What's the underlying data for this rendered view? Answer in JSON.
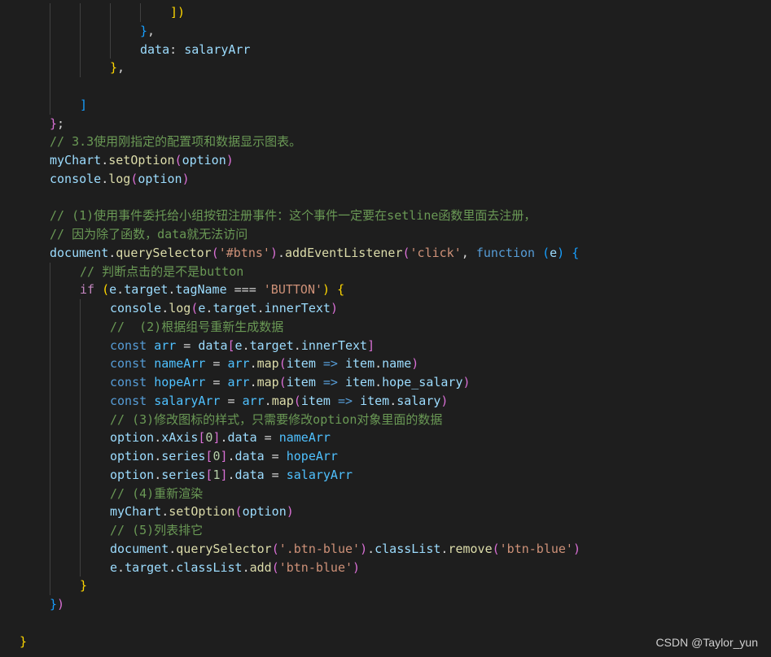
{
  "editor": {
    "theme": "dark",
    "colors": {
      "background": "#1e1e1e",
      "default": "#d4d4d4",
      "comment": "#6a9955",
      "keyword": "#569cd6",
      "control": "#c586c0",
      "variable": "#9cdcfe",
      "constvar": "#4fc1ff",
      "function": "#dcdcaa",
      "string": "#ce9178",
      "number": "#b5cea8",
      "bracket_level1": "#ffd700",
      "bracket_level2": "#da70d6",
      "bracket_level3": "#179fff"
    },
    "lines": [
      {
        "indent": 5,
        "tokens": [
          [
            "b1",
            "])"
          ]
        ]
      },
      {
        "indent": 4,
        "tokens": [
          [
            "b3",
            "}"
          ],
          [
            "default",
            ","
          ]
        ]
      },
      {
        "indent": 4,
        "tokens": [
          [
            "variable",
            "data"
          ],
          [
            "default",
            ": "
          ],
          [
            "variable",
            "salaryArr"
          ]
        ]
      },
      {
        "indent": 3,
        "tokens": [
          [
            "b1",
            "}"
          ],
          [
            "default",
            ","
          ]
        ]
      },
      {
        "indent": 2,
        "tokens": []
      },
      {
        "indent": 2,
        "tokens": [
          [
            "b3",
            "]"
          ]
        ]
      },
      {
        "indent": 1,
        "tokens": [
          [
            "b2",
            "}"
          ],
          [
            "default",
            ";"
          ]
        ]
      },
      {
        "indent": 1,
        "tokens": [
          [
            "comment",
            "// 3.3使用刚指定的配置项和数据显示图表。"
          ]
        ]
      },
      {
        "indent": 1,
        "tokens": [
          [
            "variable",
            "myChart"
          ],
          [
            "default",
            "."
          ],
          [
            "function",
            "setOption"
          ],
          [
            "b2",
            "("
          ],
          [
            "variable",
            "option"
          ],
          [
            "b2",
            ")"
          ]
        ]
      },
      {
        "indent": 1,
        "tokens": [
          [
            "variable",
            "console"
          ],
          [
            "default",
            "."
          ],
          [
            "function",
            "log"
          ],
          [
            "b2",
            "("
          ],
          [
            "variable",
            "option"
          ],
          [
            "b2",
            ")"
          ]
        ]
      },
      {
        "indent": 0,
        "tokens": []
      },
      {
        "indent": 1,
        "tokens": [
          [
            "comment",
            "// (1)使用事件委托给小组按钮注册事件：这个事件一定要在setline函数里面去注册，"
          ]
        ]
      },
      {
        "indent": 1,
        "tokens": [
          [
            "comment",
            "// 因为除了函数，data就无法访问"
          ]
        ]
      },
      {
        "indent": 1,
        "tokens": [
          [
            "variable",
            "document"
          ],
          [
            "default",
            "."
          ],
          [
            "function",
            "querySelector"
          ],
          [
            "b2",
            "("
          ],
          [
            "string",
            "'#btns'"
          ],
          [
            "b2",
            ")"
          ],
          [
            "default",
            "."
          ],
          [
            "function",
            "addEventListener"
          ],
          [
            "b2",
            "("
          ],
          [
            "string",
            "'click'"
          ],
          [
            "default",
            ", "
          ],
          [
            "keyword",
            "function"
          ],
          [
            "default",
            " "
          ],
          [
            "b3",
            "("
          ],
          [
            "variable",
            "e"
          ],
          [
            "b3",
            ")"
          ],
          [
            "default",
            " "
          ],
          [
            "b3",
            "{"
          ]
        ]
      },
      {
        "indent": 2,
        "tokens": [
          [
            "comment",
            "// 判断点击的是不是button"
          ]
        ]
      },
      {
        "indent": 2,
        "tokens": [
          [
            "control",
            "if"
          ],
          [
            "default",
            " "
          ],
          [
            "b1",
            "("
          ],
          [
            "variable",
            "e"
          ],
          [
            "default",
            "."
          ],
          [
            "variable",
            "target"
          ],
          [
            "default",
            "."
          ],
          [
            "variable",
            "tagName"
          ],
          [
            "default",
            " === "
          ],
          [
            "string",
            "'BUTTON'"
          ],
          [
            "b1",
            ")"
          ],
          [
            "default",
            " "
          ],
          [
            "b1",
            "{"
          ]
        ]
      },
      {
        "indent": 3,
        "tokens": [
          [
            "variable",
            "console"
          ],
          [
            "default",
            "."
          ],
          [
            "function",
            "log"
          ],
          [
            "b2",
            "("
          ],
          [
            "variable",
            "e"
          ],
          [
            "default",
            "."
          ],
          [
            "variable",
            "target"
          ],
          [
            "default",
            "."
          ],
          [
            "variable",
            "innerText"
          ],
          [
            "b2",
            ")"
          ]
        ]
      },
      {
        "indent": 3,
        "tokens": [
          [
            "comment",
            "//  (2)根据组号重新生成数据"
          ]
        ]
      },
      {
        "indent": 3,
        "tokens": [
          [
            "keyword",
            "const"
          ],
          [
            "default",
            " "
          ],
          [
            "constvar",
            "arr"
          ],
          [
            "default",
            " = "
          ],
          [
            "variable",
            "data"
          ],
          [
            "b2",
            "["
          ],
          [
            "variable",
            "e"
          ],
          [
            "default",
            "."
          ],
          [
            "variable",
            "target"
          ],
          [
            "default",
            "."
          ],
          [
            "variable",
            "innerText"
          ],
          [
            "b2",
            "]"
          ]
        ]
      },
      {
        "indent": 3,
        "tokens": [
          [
            "keyword",
            "const"
          ],
          [
            "default",
            " "
          ],
          [
            "constvar",
            "nameArr"
          ],
          [
            "default",
            " = "
          ],
          [
            "constvar",
            "arr"
          ],
          [
            "default",
            "."
          ],
          [
            "function",
            "map"
          ],
          [
            "b2",
            "("
          ],
          [
            "variable",
            "item"
          ],
          [
            "default",
            " "
          ],
          [
            "keyword",
            "=>"
          ],
          [
            "default",
            " "
          ],
          [
            "variable",
            "item"
          ],
          [
            "default",
            "."
          ],
          [
            "variable",
            "name"
          ],
          [
            "b2",
            ")"
          ]
        ]
      },
      {
        "indent": 3,
        "tokens": [
          [
            "keyword",
            "const"
          ],
          [
            "default",
            " "
          ],
          [
            "constvar",
            "hopeArr"
          ],
          [
            "default",
            " = "
          ],
          [
            "constvar",
            "arr"
          ],
          [
            "default",
            "."
          ],
          [
            "function",
            "map"
          ],
          [
            "b2",
            "("
          ],
          [
            "variable",
            "item"
          ],
          [
            "default",
            " "
          ],
          [
            "keyword",
            "=>"
          ],
          [
            "default",
            " "
          ],
          [
            "variable",
            "item"
          ],
          [
            "default",
            "."
          ],
          [
            "variable",
            "hope_salary"
          ],
          [
            "b2",
            ")"
          ]
        ]
      },
      {
        "indent": 3,
        "tokens": [
          [
            "keyword",
            "const"
          ],
          [
            "default",
            " "
          ],
          [
            "constvar",
            "salaryArr"
          ],
          [
            "default",
            " = "
          ],
          [
            "constvar",
            "arr"
          ],
          [
            "default",
            "."
          ],
          [
            "function",
            "map"
          ],
          [
            "b2",
            "("
          ],
          [
            "variable",
            "item"
          ],
          [
            "default",
            " "
          ],
          [
            "keyword",
            "=>"
          ],
          [
            "default",
            " "
          ],
          [
            "variable",
            "item"
          ],
          [
            "default",
            "."
          ],
          [
            "variable",
            "salary"
          ],
          [
            "b2",
            ")"
          ]
        ]
      },
      {
        "indent": 3,
        "tokens": [
          [
            "comment",
            "// (3)修改图标的样式，只需要修改option对象里面的数据"
          ]
        ]
      },
      {
        "indent": 3,
        "tokens": [
          [
            "variable",
            "option"
          ],
          [
            "default",
            "."
          ],
          [
            "variable",
            "xAxis"
          ],
          [
            "b2",
            "["
          ],
          [
            "number",
            "0"
          ],
          [
            "b2",
            "]"
          ],
          [
            "default",
            "."
          ],
          [
            "variable",
            "data"
          ],
          [
            "default",
            " = "
          ],
          [
            "constvar",
            "nameArr"
          ]
        ]
      },
      {
        "indent": 3,
        "tokens": [
          [
            "variable",
            "option"
          ],
          [
            "default",
            "."
          ],
          [
            "variable",
            "series"
          ],
          [
            "b2",
            "["
          ],
          [
            "number",
            "0"
          ],
          [
            "b2",
            "]"
          ],
          [
            "default",
            "."
          ],
          [
            "variable",
            "data"
          ],
          [
            "default",
            " = "
          ],
          [
            "constvar",
            "hopeArr"
          ]
        ]
      },
      {
        "indent": 3,
        "tokens": [
          [
            "variable",
            "option"
          ],
          [
            "default",
            "."
          ],
          [
            "variable",
            "series"
          ],
          [
            "b2",
            "["
          ],
          [
            "number",
            "1"
          ],
          [
            "b2",
            "]"
          ],
          [
            "default",
            "."
          ],
          [
            "variable",
            "data"
          ],
          [
            "default",
            " = "
          ],
          [
            "constvar",
            "salaryArr"
          ]
        ]
      },
      {
        "indent": 3,
        "tokens": [
          [
            "comment",
            "// (4)重新渲染"
          ]
        ]
      },
      {
        "indent": 3,
        "tokens": [
          [
            "variable",
            "myChart"
          ],
          [
            "default",
            "."
          ],
          [
            "function",
            "setOption"
          ],
          [
            "b2",
            "("
          ],
          [
            "variable",
            "option"
          ],
          [
            "b2",
            ")"
          ]
        ]
      },
      {
        "indent": 3,
        "tokens": [
          [
            "comment",
            "// (5)列表排它"
          ]
        ]
      },
      {
        "indent": 3,
        "tokens": [
          [
            "variable",
            "document"
          ],
          [
            "default",
            "."
          ],
          [
            "function",
            "querySelector"
          ],
          [
            "b2",
            "("
          ],
          [
            "string",
            "'.btn-blue'"
          ],
          [
            "b2",
            ")"
          ],
          [
            "default",
            "."
          ],
          [
            "variable",
            "classList"
          ],
          [
            "default",
            "."
          ],
          [
            "function",
            "remove"
          ],
          [
            "b2",
            "("
          ],
          [
            "string",
            "'btn-blue'"
          ],
          [
            "b2",
            ")"
          ]
        ]
      },
      {
        "indent": 3,
        "tokens": [
          [
            "variable",
            "e"
          ],
          [
            "default",
            "."
          ],
          [
            "variable",
            "target"
          ],
          [
            "default",
            "."
          ],
          [
            "variable",
            "classList"
          ],
          [
            "default",
            "."
          ],
          [
            "function",
            "add"
          ],
          [
            "b2",
            "("
          ],
          [
            "string",
            "'btn-blue'"
          ],
          [
            "b2",
            ")"
          ]
        ]
      },
      {
        "indent": 2,
        "tokens": [
          [
            "b1",
            "}"
          ]
        ]
      },
      {
        "indent": 1,
        "tokens": [
          [
            "b3",
            "}"
          ],
          [
            "b2",
            ")"
          ]
        ]
      },
      {
        "indent": 0,
        "tokens": []
      },
      {
        "indent": 0,
        "tokens": [
          [
            "b1",
            "}"
          ]
        ]
      }
    ]
  },
  "watermark": "CSDN @Taylor_yun"
}
